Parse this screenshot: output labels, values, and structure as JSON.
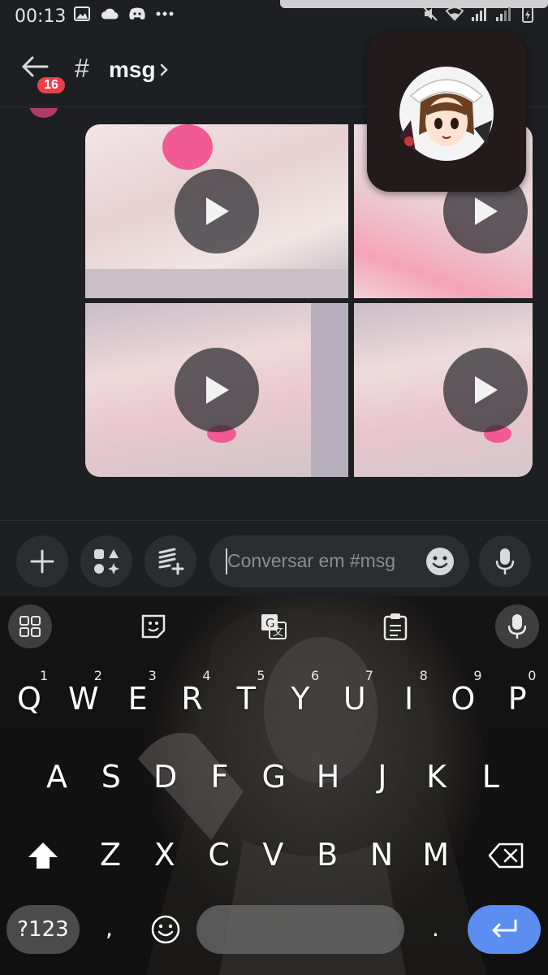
{
  "status_bar": {
    "time": "00:13",
    "left_icons": [
      "image-icon",
      "cloud-icon",
      "discord-icon",
      "more-dots-icon"
    ],
    "right_icons": [
      "mute-icon",
      "wifi-icon",
      "signal-icon",
      "signal-icon-2",
      "battery-charging-icon"
    ]
  },
  "header": {
    "unread_count": "16",
    "channel_prefix": "#",
    "channel_name": "msg"
  },
  "messages": {
    "media_tiles": [
      {
        "type": "video"
      },
      {
        "type": "video"
      },
      {
        "type": "video"
      },
      {
        "type": "video"
      }
    ]
  },
  "composer": {
    "placeholder": "Conversar em #msg"
  },
  "keyboard": {
    "toolbar": [
      "apps-grid-icon",
      "sticker-icon",
      "translate-icon",
      "clipboard-icon",
      "mic-icon"
    ],
    "row1": [
      "Q",
      "W",
      "E",
      "R",
      "T",
      "Y",
      "U",
      "I",
      "O",
      "P"
    ],
    "row1_numbers": [
      "1",
      "2",
      "3",
      "4",
      "5",
      "6",
      "7",
      "8",
      "9",
      "0"
    ],
    "row2": [
      "A",
      "S",
      "D",
      "F",
      "G",
      "H",
      "J",
      "K",
      "L"
    ],
    "row3": [
      "Z",
      "X",
      "C",
      "V",
      "B",
      "N",
      "M"
    ],
    "symbols_label": "?123",
    "comma": ",",
    "period": "."
  },
  "colors": {
    "accent_blue": "#5b8ef0",
    "badge_red": "#e8404b",
    "background": "#1e1f22"
  }
}
